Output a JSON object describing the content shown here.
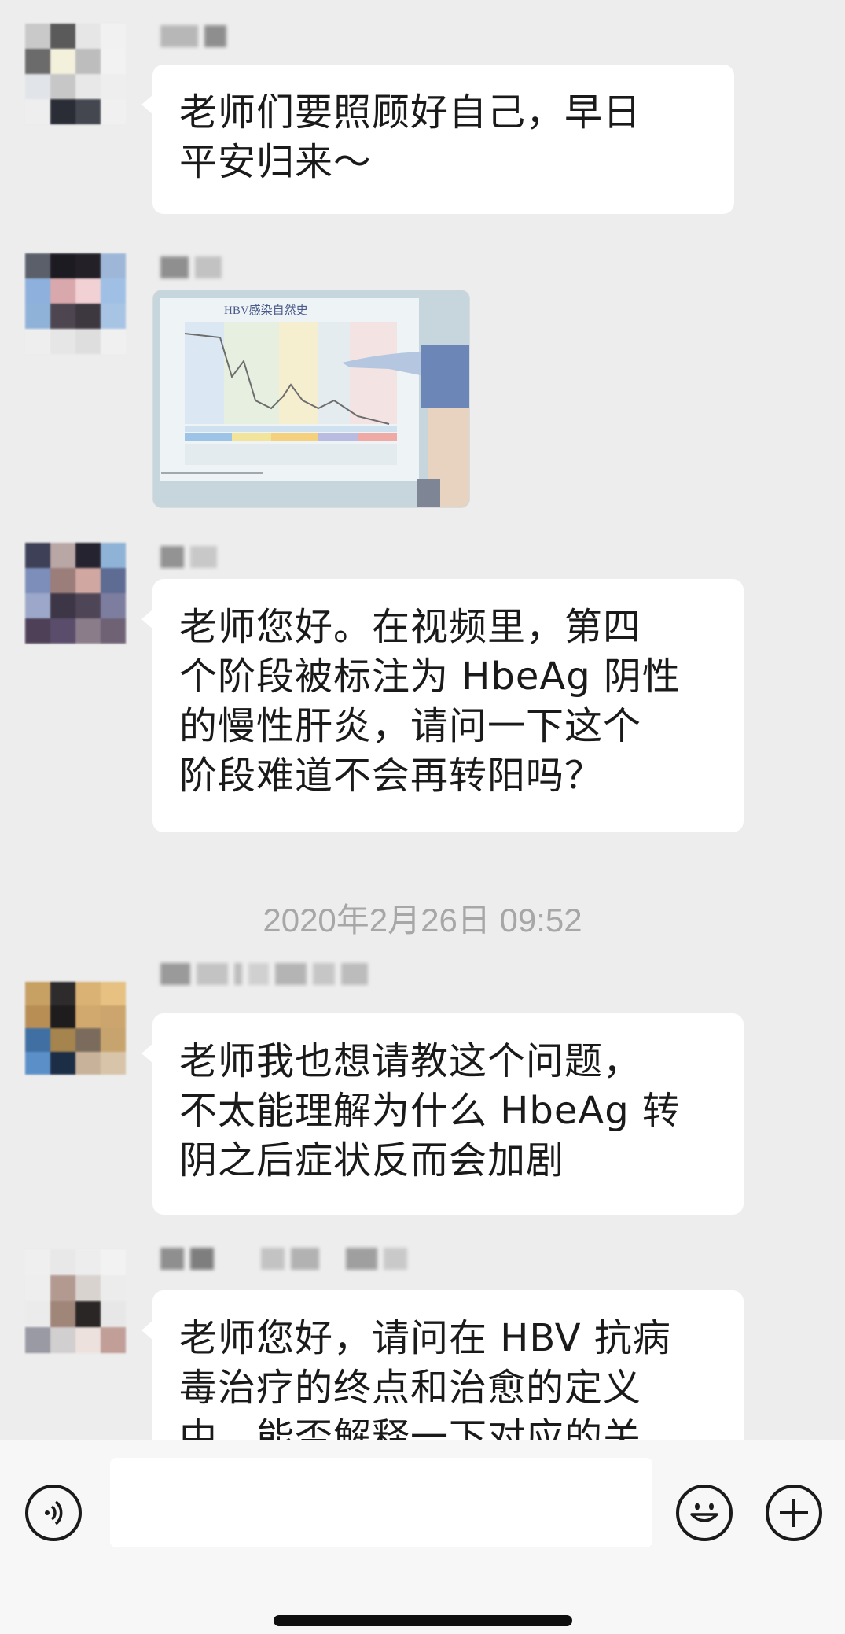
{
  "messages": [
    {
      "type": "text",
      "sender": "",
      "text": "老师们要照顾好自己，早日\n平安归来～"
    },
    {
      "type": "image",
      "sender": "",
      "image": {
        "title": "HBV感染自然史"
      }
    },
    {
      "type": "text",
      "sender": "",
      "text": "老师您好。在视频里，第四\n个阶段被标注为 HbeAg 阴性\n的慢性肝炎，请问一下这个\n阶段难道不会再转阳吗？"
    },
    {
      "type": "text",
      "sender": "",
      "text": "老师我也想请教这个问题，\n不太能理解为什么 HbeAg 转\n阴之后症状反而会加剧"
    },
    {
      "type": "text",
      "sender": "",
      "text": "老师您好，请问在 HBV 抗病\n毒治疗的终点和治愈的定义\n中，能否解释一下对应的关"
    }
  ],
  "timestamp": "2020年2月26日 09:52",
  "input_bar": {
    "voice_icon": "voice-icon",
    "emoji_icon": "emoji-icon",
    "plus_icon": "plus-icon",
    "input_value": ""
  },
  "colors": {
    "background": "#ededed",
    "bubble": "#ffffff",
    "text": "#1a1a1a",
    "timestamp": "#a7a7a7",
    "input_bar": "#f7f7f7"
  }
}
